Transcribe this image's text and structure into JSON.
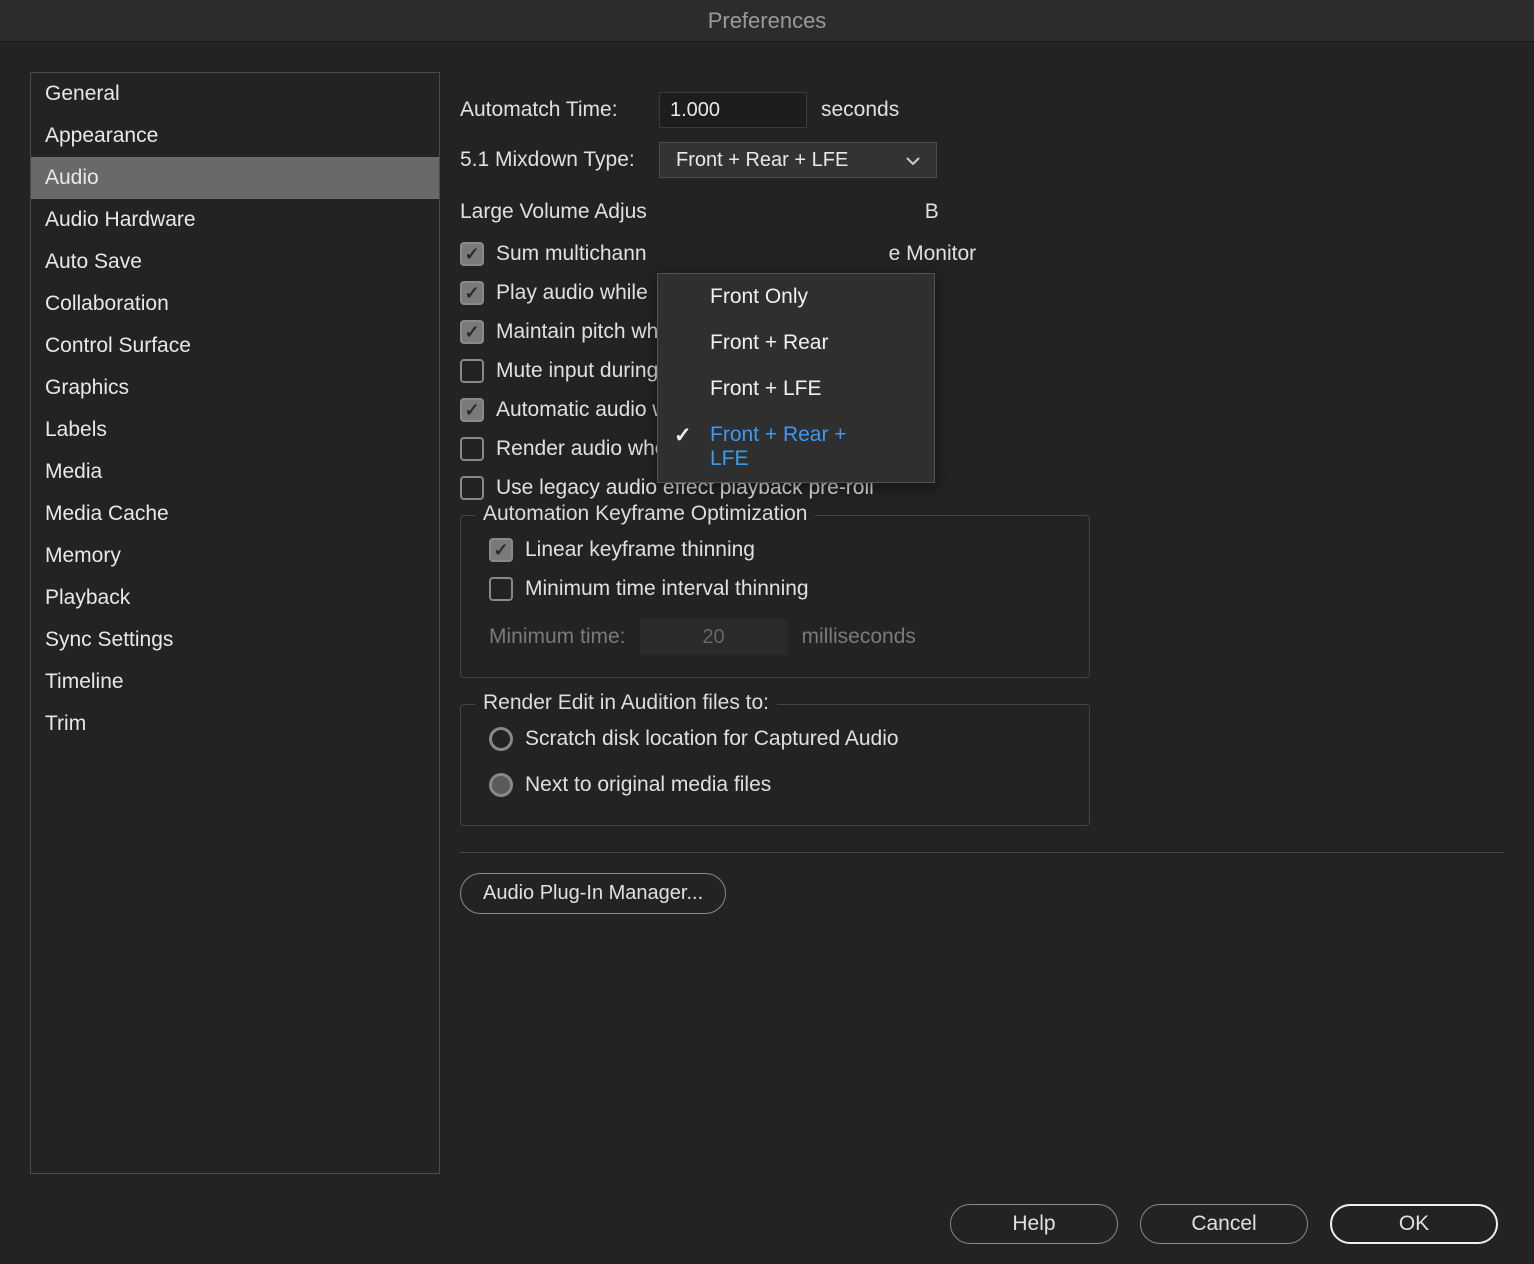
{
  "window": {
    "title": "Preferences"
  },
  "sidebar": {
    "items": [
      {
        "label": "General"
      },
      {
        "label": "Appearance"
      },
      {
        "label": "Audio",
        "selected": true
      },
      {
        "label": "Audio Hardware"
      },
      {
        "label": "Auto Save"
      },
      {
        "label": "Collaboration"
      },
      {
        "label": "Control Surface"
      },
      {
        "label": "Graphics"
      },
      {
        "label": "Labels"
      },
      {
        "label": "Media"
      },
      {
        "label": "Media Cache"
      },
      {
        "label": "Memory"
      },
      {
        "label": "Playback"
      },
      {
        "label": "Sync Settings"
      },
      {
        "label": "Timeline"
      },
      {
        "label": "Trim"
      }
    ]
  },
  "content": {
    "automatch": {
      "label": "Automatch Time:",
      "value": "1.000",
      "unit": "seconds"
    },
    "mixdown": {
      "label": "5.1 Mixdown Type:",
      "value": "Front + Rear + LFE",
      "options": [
        {
          "label": "Front Only"
        },
        {
          "label": "Front + Rear"
        },
        {
          "label": "Front + LFE"
        },
        {
          "label": "Front + Rear + LFE",
          "selected": true
        }
      ]
    },
    "large_volume_prefix": "Large Volume Adjus",
    "large_volume_suffix": "B",
    "checks": [
      {
        "prefix": "Sum multichann",
        "suffix": "e Monitor",
        "checked": true
      },
      {
        "prefix": "Play audio while",
        "suffix": "",
        "checked": true
      },
      {
        "label": "Maintain pitch while shuttling",
        "checked": true
      },
      {
        "label": "Mute input during timeline recording",
        "checked": false
      },
      {
        "label": "Automatic audio waveform generation",
        "checked": true
      },
      {
        "label": "Render audio when rendering video",
        "checked": false
      },
      {
        "label": "Use legacy audio effect playback pre-roll",
        "checked": false
      }
    ],
    "automation": {
      "legend": "Automation Keyframe Optimization",
      "linear": {
        "label": "Linear keyframe thinning",
        "checked": true
      },
      "interval": {
        "label": "Minimum time interval thinning",
        "checked": false
      },
      "min_time": {
        "label": "Minimum time:",
        "value": "20",
        "unit": "milliseconds"
      }
    },
    "render": {
      "legend": "Render Edit in Audition files to:",
      "opt1": "Scratch disk location for Captured Audio",
      "opt2": "Next to original media files"
    },
    "plugin_btn": "Audio Plug-In Manager..."
  },
  "footer": {
    "help": "Help",
    "cancel": "Cancel",
    "ok": "OK"
  }
}
